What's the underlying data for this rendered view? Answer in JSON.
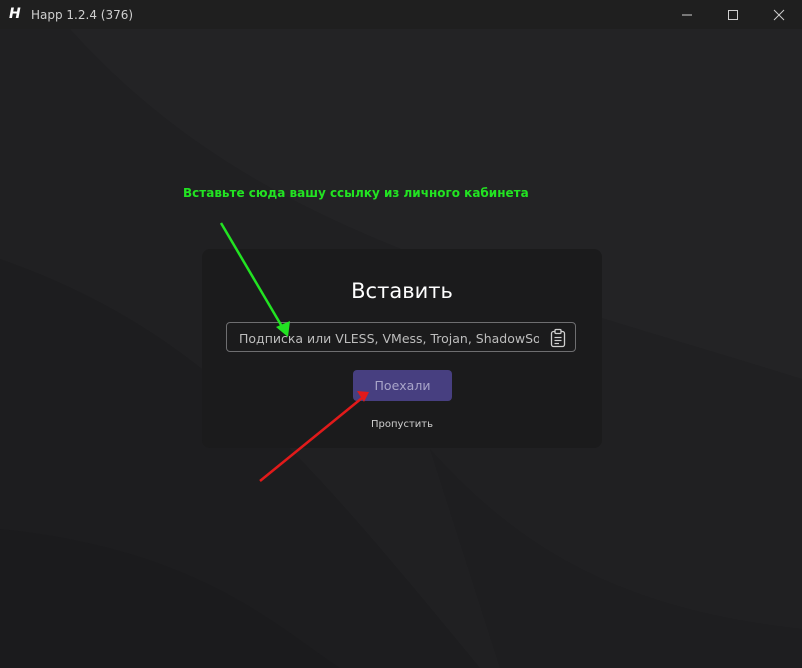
{
  "window": {
    "title": "Happ 1.2.4 (376)",
    "logo_icon": "happ-logo-icon",
    "controls": [
      "minimize-icon",
      "maximize-icon",
      "close-icon"
    ]
  },
  "dialog": {
    "title": "Вставить",
    "input": {
      "value": "",
      "placeholder": "Подписка или VLESS, VMess, Trojan, ShadowSo..."
    },
    "paste_icon": "clipboard-icon",
    "primary_button": "Поехали",
    "skip_link": "Пропустить"
  },
  "annotation": {
    "text": "Вставьте сюда вашу ссылку из личного кабинета",
    "text_color": "#22e322",
    "arrow_colors": [
      "#22e322",
      "#e11a1a"
    ]
  },
  "colors": {
    "background": "#202022",
    "dialog": "#1b1b1c",
    "accent_button": "#473f80"
  }
}
